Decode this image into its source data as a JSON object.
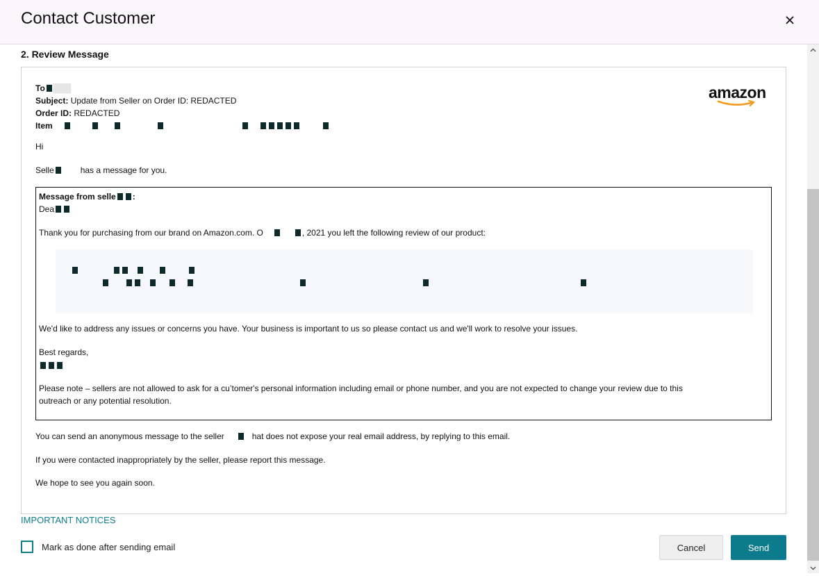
{
  "dialog": {
    "title": "Contact Customer",
    "close_icon": "close-icon"
  },
  "section": {
    "title": "2. Review Message"
  },
  "email": {
    "logo_text": "amazon",
    "to_label": "To",
    "subject_label": "Subject:",
    "subject_value": "Update from Seller on Order ID: REDACTED",
    "order_label": "Order ID:",
    "order_value": "REDACTED",
    "item_label": "Item",
    "greeting": "Hi",
    "seller_intro_prefix": "Selle",
    "seller_intro_suffix": "has a message for you.",
    "message_box": {
      "heading_prefix": "Message from selle",
      "heading_suffix": ":",
      "dear": "Dea",
      "thanks_prefix": "Thank you for purchasing from our brand on Amazon.com. O",
      "thanks_suffix": ", 2021 you left the following review of our product:",
      "address_issues": "We'd like to address any issues or concerns you have. Your business is important to us so please contact us and we'll work to resolve your issues.",
      "regards": "Best regards,",
      "note_line1": "Please note – sellers are not allowed to ask for a cu’tomer's personal information including email or phone number, and you are not expected to change your review due to this",
      "note_line2": "outreach or any potential resolution."
    },
    "anon_prefix": "You can send an anonymous message to the seller",
    "anon_suffix": "hat does not expose your real email address, by replying to this email.",
    "report_line": "If you were contacted inappropriately by the seller, please report this message.",
    "closing_line": "We hope to see you again soon."
  },
  "footer": {
    "notices_link": "IMPORTANT NOTICES",
    "checkbox_label": "Mark as done after sending email",
    "cancel_label": "Cancel",
    "send_label": "Send"
  },
  "colors": {
    "accent": "#0c7b8b",
    "header_bg": "#fbf6fb"
  }
}
